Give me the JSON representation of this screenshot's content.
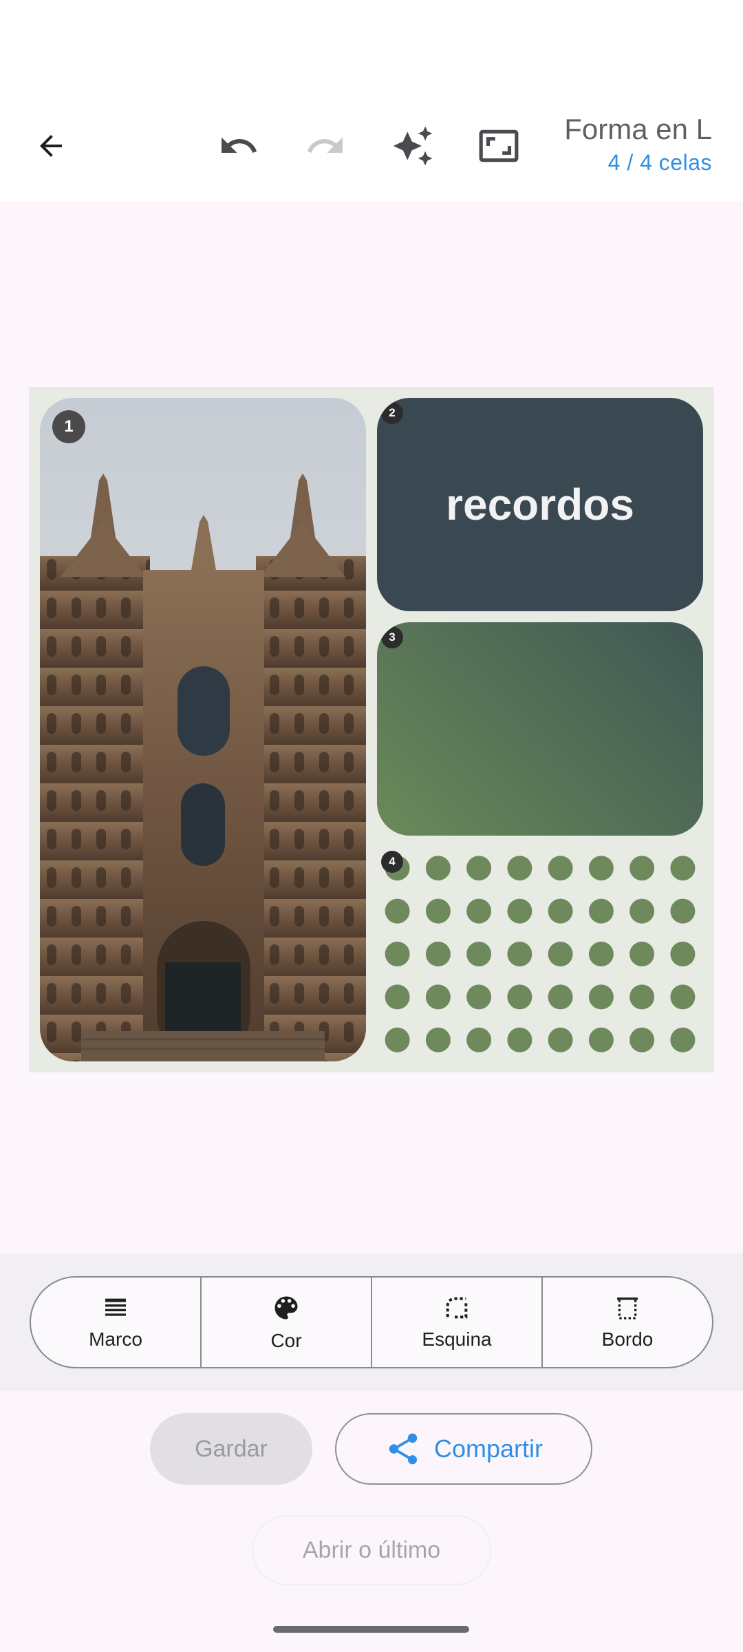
{
  "header": {
    "title": "Forma en L",
    "cells_count": "4 / 4 celas",
    "icons": [
      "back-arrow-icon",
      "undo-icon",
      "redo-icon",
      "sparkle-icon",
      "aspect-ratio-icon"
    ]
  },
  "collage": {
    "cell_badges": [
      "1",
      "2",
      "3",
      "4"
    ],
    "cell2_text": "recordos",
    "colors": {
      "background": "#e7ebe4",
      "cell2": "#394851",
      "cell3_gradient": [
        "#6b8a59",
        "#3f5654"
      ],
      "dots": "#6e8a5d"
    }
  },
  "tools": {
    "items": [
      {
        "label": "Marco",
        "icon": "frame-lines-icon"
      },
      {
        "label": "Cor",
        "icon": "palette-icon"
      },
      {
        "label": "Esquina",
        "icon": "corner-icon"
      },
      {
        "label": "Bordo",
        "icon": "border-icon"
      }
    ]
  },
  "actions": {
    "save": "Gardar",
    "share": "Compartir",
    "open_last": "Abrir o último"
  },
  "colors": {
    "accent": "#2f8fe6"
  }
}
